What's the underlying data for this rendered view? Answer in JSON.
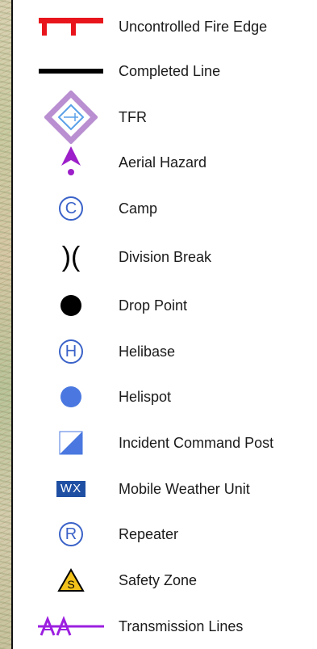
{
  "legend": {
    "items": [
      {
        "label": "Uncontrolled Fire Edge",
        "icon": "uncontrolled-fire-edge-icon",
        "color": "#e8161c"
      },
      {
        "label": "Completed Line",
        "icon": "completed-line-icon",
        "color": "#000000"
      },
      {
        "label": "TFR",
        "icon": "tfr-icon",
        "color": "#b98fd1"
      },
      {
        "label": "Aerial Hazard",
        "icon": "aerial-hazard-icon",
        "color": "#9c1fc9"
      },
      {
        "label": "Camp",
        "icon": "camp-icon",
        "color": "#3a62c8",
        "glyph": "C"
      },
      {
        "label": "Division Break",
        "icon": "division-break-icon",
        "color": "#000000",
        "glyph": ")("
      },
      {
        "label": "Drop Point",
        "icon": "drop-point-icon",
        "color": "#000000"
      },
      {
        "label": "Helibase",
        "icon": "helibase-icon",
        "color": "#3a62c8",
        "glyph": "H"
      },
      {
        "label": "Helispot",
        "icon": "helispot-icon",
        "color": "#4a78e0"
      },
      {
        "label": "Incident Command Post",
        "icon": "incident-command-post-icon",
        "color": "#4a78e0"
      },
      {
        "label": "Mobile Weather Unit",
        "icon": "mobile-weather-unit-icon",
        "color": "#1f4fa3",
        "glyph": "WX"
      },
      {
        "label": "Repeater",
        "icon": "repeater-icon",
        "color": "#3a62c8",
        "glyph": "R"
      },
      {
        "label": "Safety Zone",
        "icon": "safety-zone-icon",
        "color": "#f2c21a",
        "glyph": "S"
      },
      {
        "label": "Transmission Lines",
        "icon": "transmission-lines-icon",
        "color": "#9c1fe0"
      }
    ]
  }
}
